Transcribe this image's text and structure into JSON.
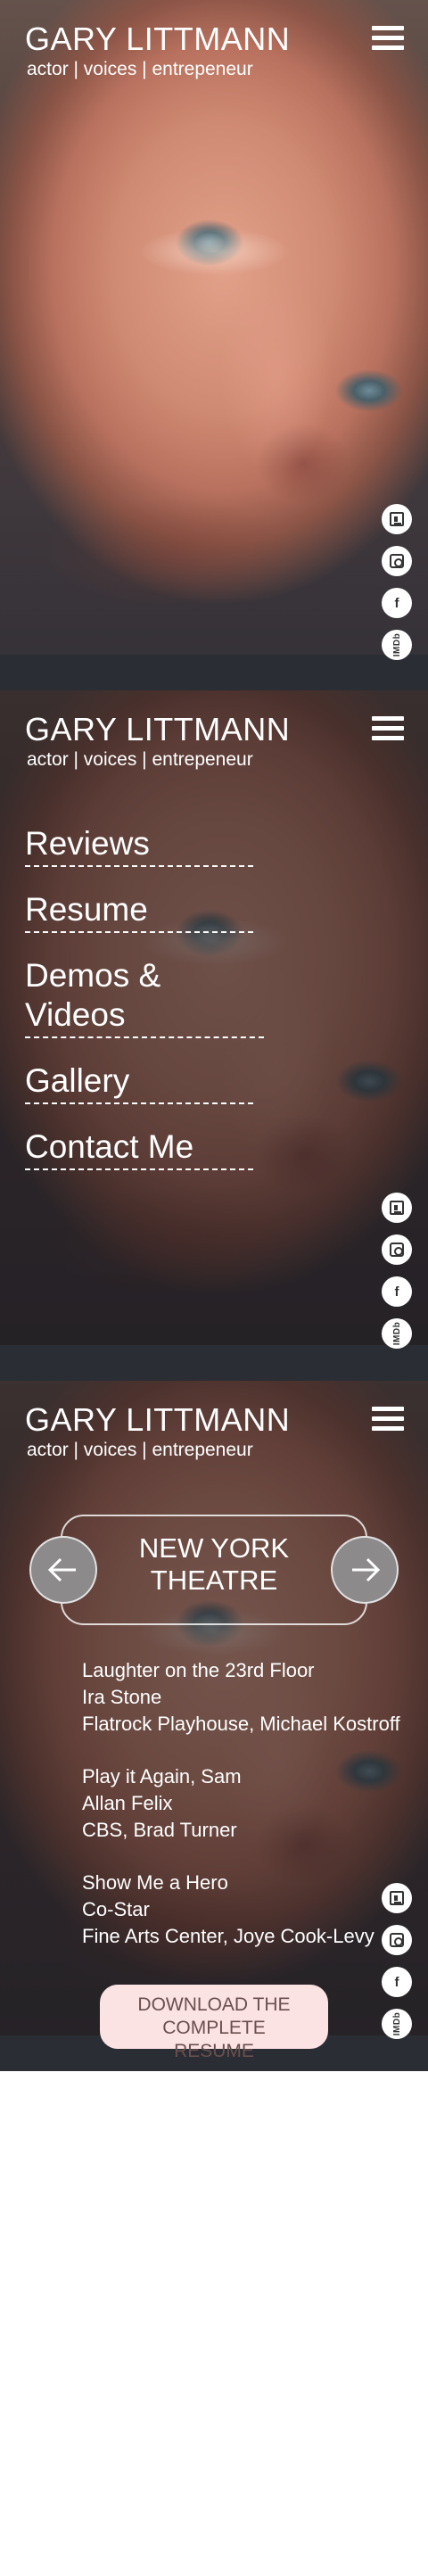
{
  "site": {
    "name": "GARY LITTMANN",
    "tagline": "actor | voices | entrepeneur"
  },
  "social_icons": [
    "resume-icon",
    "instagram-icon",
    "facebook-icon",
    "imdb-icon"
  ],
  "social_imdb_text": "IMDb",
  "menu": {
    "items": [
      "Reviews",
      "Resume",
      "Demos & Videos",
      "Gallery",
      "Contact Me"
    ]
  },
  "resume": {
    "category": "NEW YORK THEATRE",
    "credits": [
      {
        "show": "Laughter on the 23rd Floor",
        "role": "Ira Stone",
        "venue": "Flatrock Playhouse, Michael Kostroff"
      },
      {
        "show": "Play it Again, Sam",
        "role": "Allan Felix",
        "venue": "CBS, Brad Turner"
      },
      {
        "show": "Show Me a Hero",
        "role": "Co-Star",
        "venue": "Fine Arts Center, Joye Cook-Levy"
      }
    ],
    "download_label": "DOWNLOAD THE COMPLETE RESUME"
  }
}
